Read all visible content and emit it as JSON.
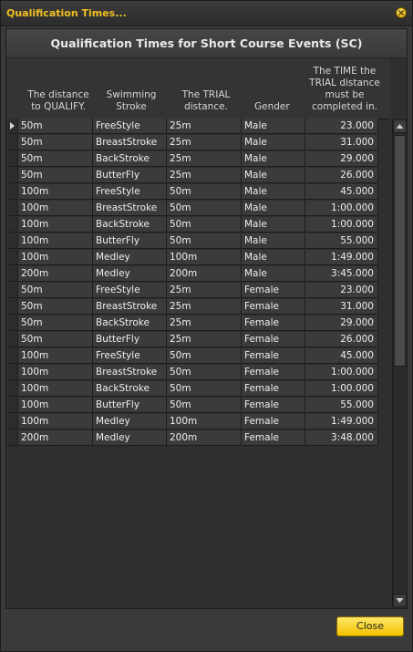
{
  "window": {
    "title": "Qualification Times..."
  },
  "heading": "Qualification Times for Short Course Events (SC)",
  "columns": [
    "The distance to QUALIFY.",
    "Swimming Stroke",
    "The TRIAL distance.",
    "Gender",
    "The TIME the TRIAL distance must be completed in."
  ],
  "rows": [
    [
      "50m",
      "FreeStyle",
      "25m",
      "Male",
      "23.000"
    ],
    [
      "50m",
      "BreastStroke",
      "25m",
      "Male",
      "31.000"
    ],
    [
      "50m",
      "BackStroke",
      "25m",
      "Male",
      "29.000"
    ],
    [
      "50m",
      "ButterFly",
      "25m",
      "Male",
      "26.000"
    ],
    [
      "100m",
      "FreeStyle",
      "50m",
      "Male",
      "45.000"
    ],
    [
      "100m",
      "BreastStroke",
      "50m",
      "Male",
      "1:00.000"
    ],
    [
      "100m",
      "BackStroke",
      "50m",
      "Male",
      "1:00.000"
    ],
    [
      "100m",
      "ButterFly",
      "50m",
      "Male",
      "55.000"
    ],
    [
      "100m",
      "Medley",
      "100m",
      "Male",
      "1:49.000"
    ],
    [
      "200m",
      "Medley",
      "200m",
      "Male",
      "3:45.000"
    ],
    [
      "50m",
      "FreeStyle",
      "25m",
      "Female",
      "23.000"
    ],
    [
      "50m",
      "BreastStroke",
      "25m",
      "Female",
      "31.000"
    ],
    [
      "50m",
      "BackStroke",
      "25m",
      "Female",
      "29.000"
    ],
    [
      "50m",
      "ButterFly",
      "25m",
      "Female",
      "26.000"
    ],
    [
      "100m",
      "FreeStyle",
      "50m",
      "Female",
      "45.000"
    ],
    [
      "100m",
      "BreastStroke",
      "50m",
      "Female",
      "1:00.000"
    ],
    [
      "100m",
      "BackStroke",
      "50m",
      "Female",
      "1:00.000"
    ],
    [
      "100m",
      "ButterFly",
      "50m",
      "Female",
      "55.000"
    ],
    [
      "100m",
      "Medley",
      "100m",
      "Female",
      "1:49.000"
    ],
    [
      "200m",
      "Medley",
      "200m",
      "Female",
      "3:48.000"
    ]
  ],
  "selected_row": 0,
  "buttons": {
    "close": "Close"
  },
  "colors": {
    "accent": "#f2c200",
    "title": "#f0c020"
  },
  "icons": {
    "close": "close-icon",
    "scroll_up": "chevron-up-icon",
    "scroll_down": "chevron-down-icon",
    "row_indicator": "row-pointer-icon"
  }
}
